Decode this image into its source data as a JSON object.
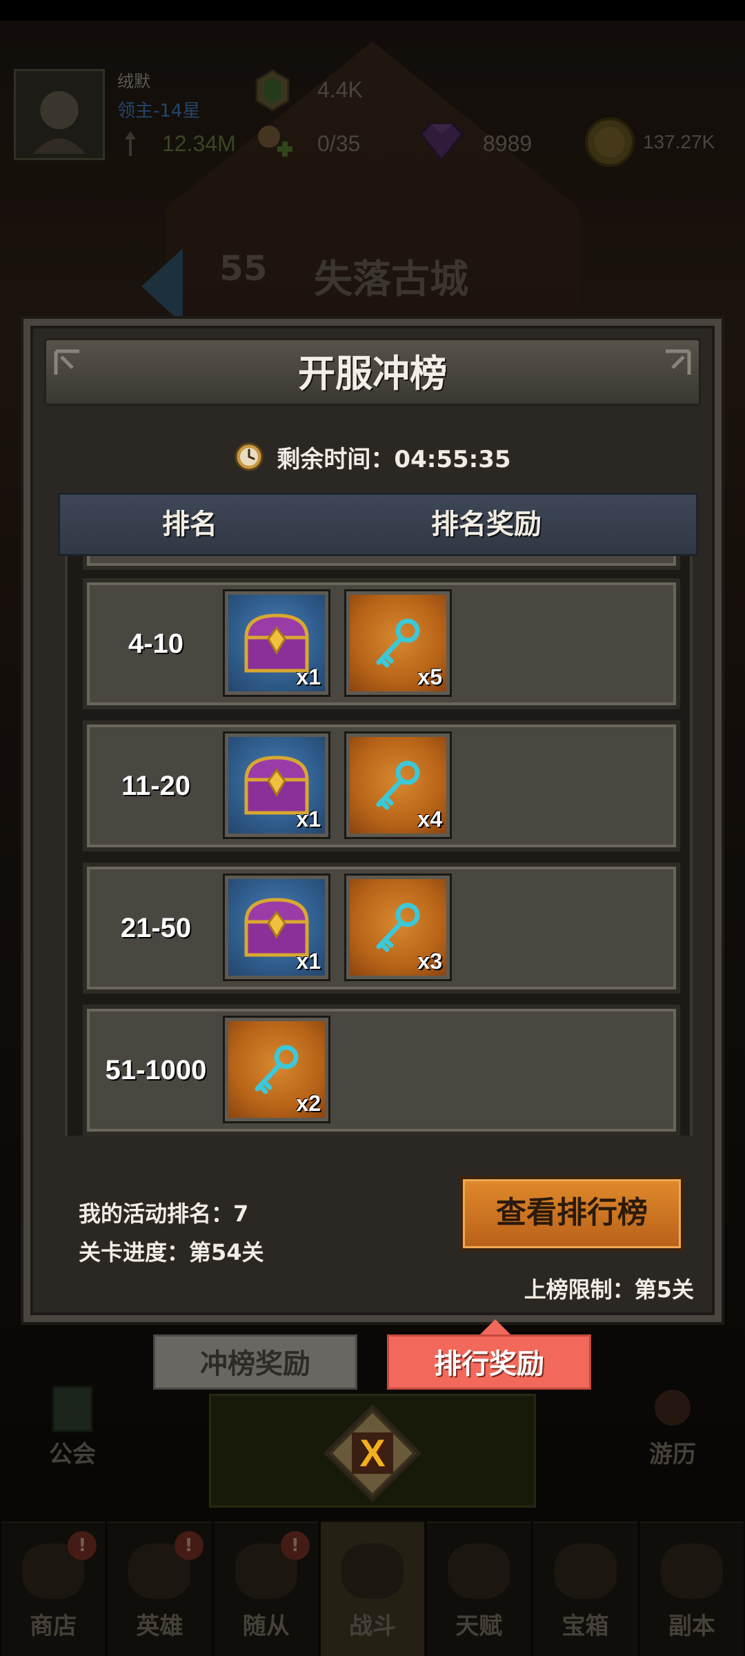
{
  "player": {
    "name": "绒默",
    "rank": "领主-14星",
    "power": "12.34M",
    "energy": "4.4K",
    "followers": "0/35",
    "gems": "8989",
    "gold": "137.27K"
  },
  "stage": {
    "number": "55",
    "name": "失落古城"
  },
  "side": {
    "guild": "公会",
    "travel": "游历"
  },
  "modal": {
    "title": "开服冲榜",
    "timer": "剩余时间：04:55:35",
    "columns": {
      "rank": "排名",
      "reward": "排名奖励"
    },
    "rows": [
      {
        "rank": "4-10",
        "items": [
          {
            "type": "chest",
            "qty": "x1"
          },
          {
            "type": "key",
            "qty": "x5"
          }
        ]
      },
      {
        "rank": "11-20",
        "items": [
          {
            "type": "chest",
            "qty": "x1"
          },
          {
            "type": "key",
            "qty": "x4"
          }
        ]
      },
      {
        "rank": "21-50",
        "items": [
          {
            "type": "chest",
            "qty": "x1"
          },
          {
            "type": "key",
            "qty": "x3"
          }
        ]
      },
      {
        "rank": "51-1000",
        "items": [
          {
            "type": "key",
            "qty": "x2"
          }
        ]
      }
    ],
    "my_rank": "我的活动排名：7",
    "progress": "关卡进度：第54关",
    "view_button": "查看排行榜",
    "limit": "上榜限制：第5关"
  },
  "tabs": {
    "rush_reward": "冲榜奖励",
    "rank_reward": "排行奖励"
  },
  "close_label": "X",
  "nav": [
    {
      "label": "商店",
      "badge": "!"
    },
    {
      "label": "英雄",
      "badge": "!"
    },
    {
      "label": "随从",
      "badge": "!"
    },
    {
      "label": "战斗",
      "badge": ""
    },
    {
      "label": "天赋",
      "badge": ""
    },
    {
      "label": "宝箱",
      "badge": ""
    },
    {
      "label": "副本",
      "badge": ""
    }
  ],
  "colors": {
    "active_tab": "#f2685a",
    "view_button": "#e08a2c",
    "header": "#3d4756"
  },
  "icons": [
    "clock-icon",
    "chest-icon",
    "key-icon",
    "close-icon"
  ]
}
